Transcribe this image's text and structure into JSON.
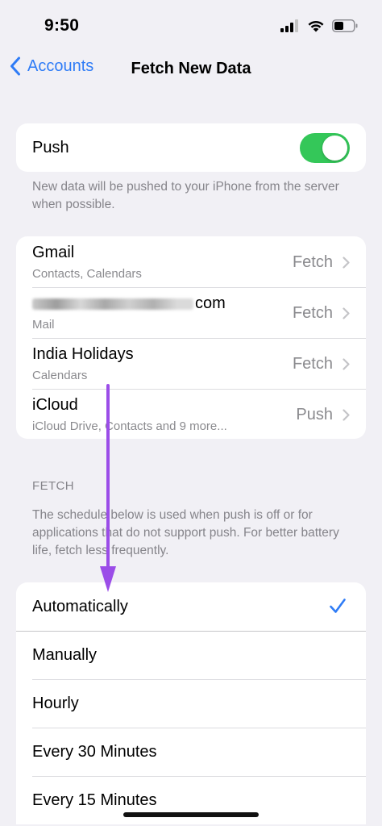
{
  "status": {
    "time": "9:50"
  },
  "nav": {
    "back_label": "Accounts",
    "title": "Fetch New Data"
  },
  "push": {
    "label": "Push",
    "enabled": true,
    "footnote": "New data will be pushed to your iPhone from the server when possible."
  },
  "accounts": [
    {
      "name": "Gmail",
      "detail": "Contacts, Calendars",
      "value": "Fetch"
    },
    {
      "name": "com",
      "detail": "Mail",
      "value": "Fetch"
    },
    {
      "name": "India Holidays",
      "detail": "Calendars",
      "value": "Fetch"
    },
    {
      "name": "iCloud",
      "detail": "iCloud Drive, Contacts and 9 more...",
      "value": "Push"
    }
  ],
  "fetch_section": {
    "header": "FETCH",
    "footnote": "The schedule below is used when push is off or for applications that do not support push. For better battery life, fetch less frequently."
  },
  "schedule": {
    "selected_index": 0,
    "options": [
      "Automatically",
      "Manually",
      "Hourly",
      "Every 30 Minutes",
      "Every 15 Minutes"
    ]
  },
  "colors": {
    "accent": "#2f7cf6",
    "toggle_on": "#34c759",
    "annotation_arrow": "#9b4de8"
  }
}
